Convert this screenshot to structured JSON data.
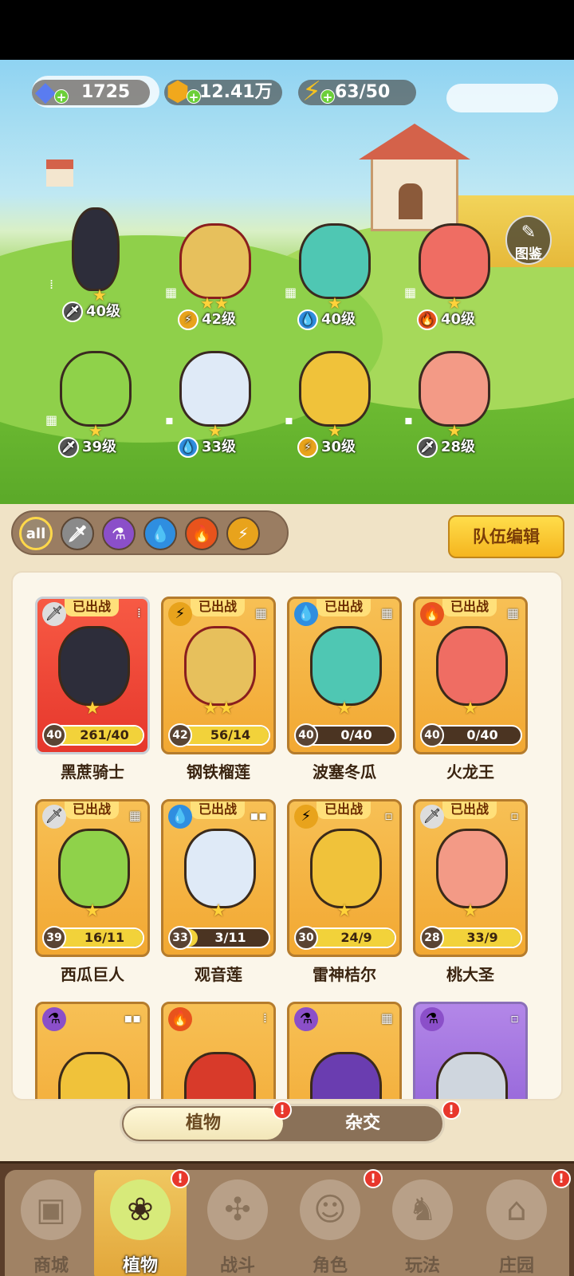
{
  "resources": {
    "gems": "1725",
    "gold": "12.41万",
    "energy": "63/50"
  },
  "codex_label": "图鉴",
  "scene_heroes": [
    {
      "level": "40级",
      "element": "sword",
      "stars": "★"
    },
    {
      "level": "42级",
      "element": "lightning",
      "stars": "★★"
    },
    {
      "level": "40级",
      "element": "water",
      "stars": "★"
    },
    {
      "level": "40级",
      "element": "fire",
      "stars": "★"
    },
    {
      "level": "39级",
      "element": "sword",
      "stars": "★"
    },
    {
      "level": "33级",
      "element": "water",
      "stars": "★"
    },
    {
      "level": "30级",
      "element": "lightning",
      "stars": "★"
    },
    {
      "level": "28级",
      "element": "sword",
      "stars": "★"
    }
  ],
  "filters": {
    "all": "all",
    "items": [
      "sword-icon",
      "potion-icon",
      "water-icon",
      "fire-icon",
      "lightning-icon"
    ]
  },
  "team_edit_label": "队伍编辑",
  "deployed_tag": "已出战",
  "plants": [
    {
      "name": "黑蔗骑士",
      "level": "40",
      "progress": "261/40",
      "stars": "★",
      "fill": 1.0
    },
    {
      "name": "钢铁榴莲",
      "level": "42",
      "progress": "56/14",
      "stars": "★★",
      "fill": 1.0
    },
    {
      "name": "波塞冬瓜",
      "level": "40",
      "progress": "0/40",
      "stars": "★",
      "fill": 0.0
    },
    {
      "name": "火龙王",
      "level": "40",
      "progress": "0/40",
      "stars": "★",
      "fill": 0.0
    },
    {
      "name": "西瓜巨人",
      "level": "39",
      "progress": "16/11",
      "stars": "★",
      "fill": 1.0
    },
    {
      "name": "观音莲",
      "level": "33",
      "progress": "3/11",
      "stars": "★",
      "fill": 0.27
    },
    {
      "name": "雷神桔尔",
      "level": "30",
      "progress": "24/9",
      "stars": "★",
      "fill": 1.0
    },
    {
      "name": "桃大圣",
      "level": "28",
      "progress": "33/9",
      "stars": "★",
      "fill": 1.0
    }
  ],
  "toggle": {
    "plants": "植物",
    "hybrid": "杂交",
    "badge": "!"
  },
  "nav": [
    {
      "label": "商城"
    },
    {
      "label": "植物"
    },
    {
      "label": "战斗"
    },
    {
      "label": "角色"
    },
    {
      "label": "玩法"
    },
    {
      "label": "庄园"
    }
  ],
  "colors": {
    "accent_gold": "#f5b51f",
    "badge_red": "#e8372c",
    "panel_bg": "#f0e3c6"
  }
}
